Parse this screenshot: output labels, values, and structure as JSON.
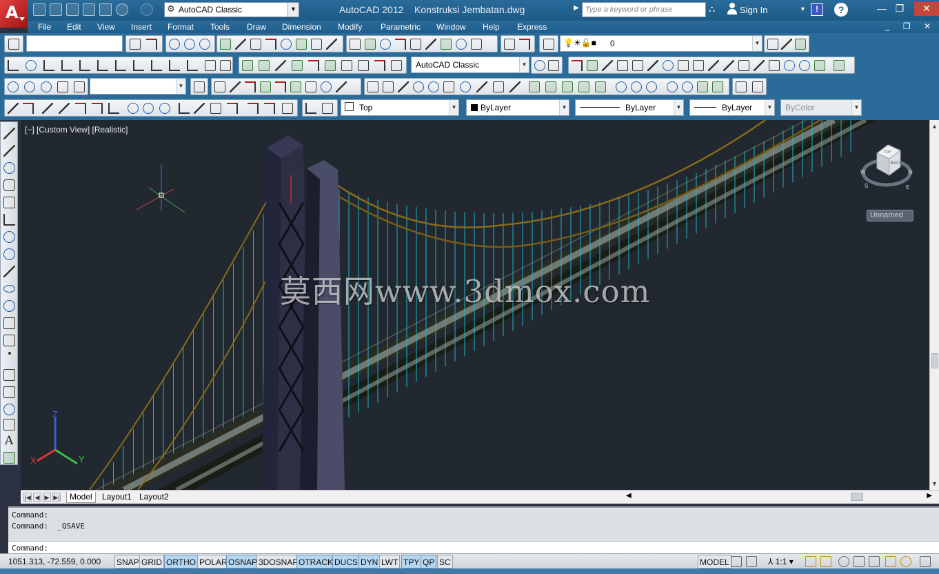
{
  "title_bar": {
    "app_title": "AutoCAD 2012",
    "file_name": "Konstruksi Jembatan.dwg",
    "workspace": "AutoCAD Classic",
    "search_placeholder": "Type a keyword or phrase",
    "sign_in": "Sign In",
    "help_icon": "?",
    "window_controls": [
      "—",
      "❐",
      "✕"
    ]
  },
  "menu": {
    "items": [
      "File",
      "Edit",
      "View",
      "Insert",
      "Format",
      "Tools",
      "Draw",
      "Dimension",
      "Modify",
      "Parametric",
      "Window",
      "Help",
      "Express"
    ],
    "mdi_controls": "_ ❐ ✕"
  },
  "toolbars": {
    "layer_value": "0",
    "style_value": "AutoCAD Classic",
    "view_value": "Top",
    "color_value": "ByLayer",
    "linetype_value": "ByLayer",
    "lineweight_value": "ByLayer",
    "plotstyle_value": "ByColor"
  },
  "viewport": {
    "view_label": "[−] [Custom View] [Realistic]",
    "named_view_button": "Unnamed",
    "watermark": "莫西网www.3dmox.com",
    "viewcube_face_top": "TOP",
    "viewcube_face_back": "BACK",
    "compass_labels": [
      "N",
      "E",
      "W",
      "S"
    ],
    "ucs_axes": [
      "X",
      "Y",
      "Z"
    ]
  },
  "layout_tabs": [
    "Model",
    "Layout1",
    "Layout2"
  ],
  "command_window": {
    "history": [
      "Command:",
      "Command:  _QSAVE"
    ],
    "prompt": "Command:"
  },
  "status_bar": {
    "coordinates": "1051.313, -72.559, 0.000",
    "toggles": [
      {
        "label": "SNAP",
        "on": false
      },
      {
        "label": "GRID",
        "on": false
      },
      {
        "label": "ORTHO",
        "on": true
      },
      {
        "label": "POLAR",
        "on": false
      },
      {
        "label": "OSNAP",
        "on": true
      },
      {
        "label": "3DOSNAP",
        "on": false
      },
      {
        "label": "OTRACK",
        "on": true
      },
      {
        "label": "DUCS",
        "on": true
      },
      {
        "label": "DYN",
        "on": true
      },
      {
        "label": "LWT",
        "on": false
      },
      {
        "label": "TPY",
        "on": true
      },
      {
        "label": "QP",
        "on": true
      },
      {
        "label": "SC",
        "on": false
      }
    ],
    "space": "MODEL",
    "annotation_scale": "1:1"
  },
  "colors": {
    "title_bar": "#1d5a86",
    "viewport_bg": "#212830",
    "cable": "#8a6a1a",
    "hanger": "#21b5c6",
    "tower": "#2d2f45",
    "toggle_on": "#b5d6f0"
  }
}
